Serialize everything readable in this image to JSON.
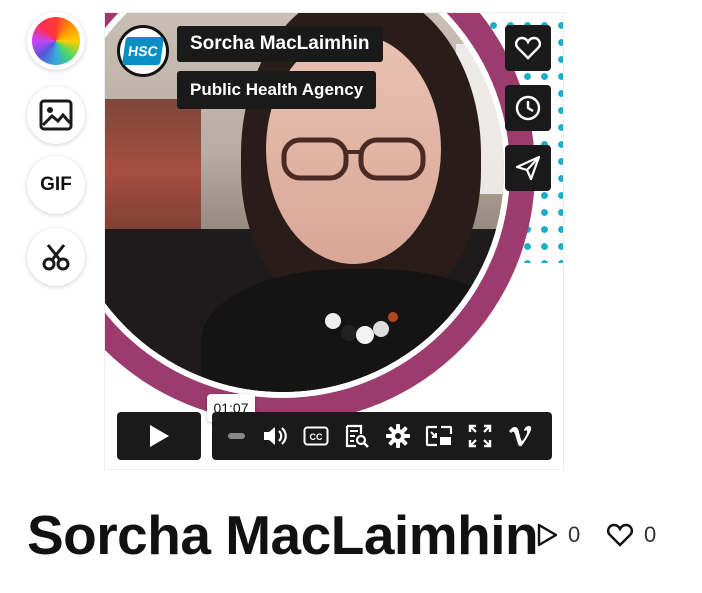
{
  "tools": [
    {
      "name": "color-picker",
      "icon": "color-wheel-icon"
    },
    {
      "name": "image",
      "icon": "image-icon"
    },
    {
      "name": "gif",
      "label": "GIF"
    },
    {
      "name": "clip",
      "icon": "scissors-icon"
    }
  ],
  "video": {
    "badge_logo_text": "HSC",
    "presenter_name": "Sorcha MacLaimhin",
    "presenter_org": "Public Health Agency",
    "side_actions": [
      "heart-icon",
      "clock-icon",
      "send-icon"
    ],
    "player": {
      "time_tooltip": "01:07",
      "controls": [
        "play-icon",
        "progress-scrubber",
        "volume-icon",
        "captions-icon",
        "transcript-icon",
        "settings-icon",
        "pip-icon",
        "fullscreen-icon",
        "vimeo-logo"
      ]
    },
    "colors": {
      "ring": "#9c3b6e",
      "dots": "#1aaec8",
      "control_bg": "#1a1a1a"
    }
  },
  "title": "Sorcha MacLaimhin",
  "stats": {
    "plays": "0",
    "likes": "0"
  }
}
